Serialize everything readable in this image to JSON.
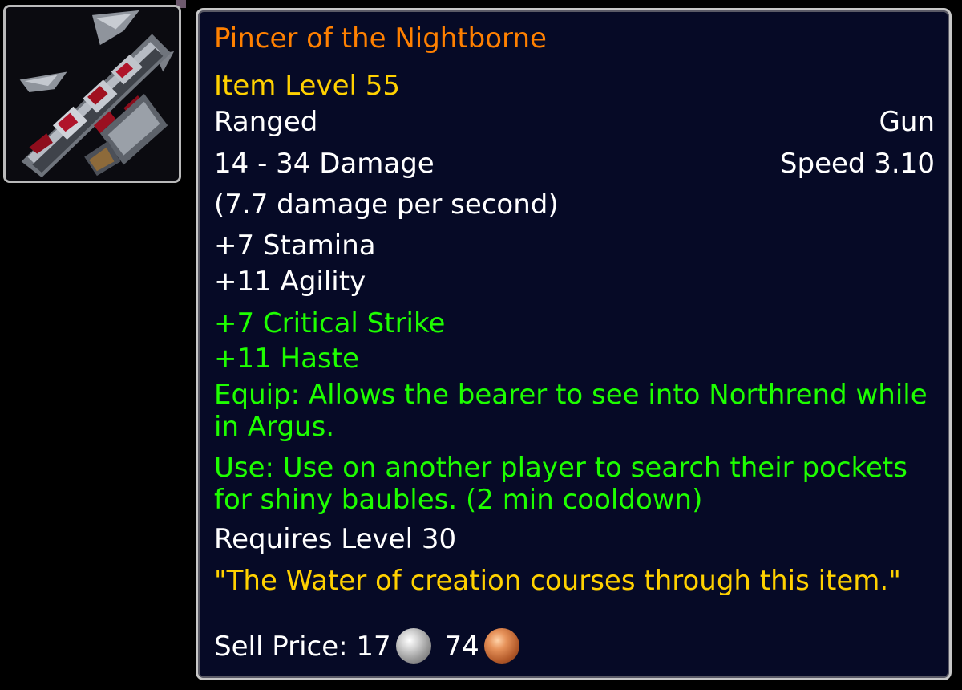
{
  "item": {
    "name": "Pincer of the Nightborne",
    "item_level": "Item Level 55",
    "slot": "Ranged",
    "type": "Gun",
    "damage": "14 - 34 Damage",
    "speed": "Speed 3.10",
    "dps": "(7.7 damage per second)",
    "stats": [
      "+7 Stamina",
      "+11 Agility"
    ],
    "secondary_stats": [
      "+7 Critical Strike",
      "+11 Haste"
    ],
    "equip_effect": "Equip: Allows the bearer to see into Northrend while in Argus.",
    "use_effect": "Use: Use on another player to search their pockets for shiny baubles. (2 min cooldown)",
    "requires": "Requires Level 30",
    "flavor": "\"The Water of creation courses through this item.\"",
    "sell_price": {
      "label": "Sell Price:",
      "silver": "17",
      "copper": "74"
    }
  },
  "icons": {
    "item_icon": "gun-icon",
    "silver_coin": "silver-coin-icon",
    "copper_coin": "copper-coin-icon"
  },
  "colors": {
    "legendary_name": "#ff8000",
    "item_level": "#ffd100",
    "normal_text": "#ffffff",
    "bonus_text": "#1eff00",
    "flavor_text": "#ffd100",
    "tooltip_bg": "#060a26",
    "border": "#c7c7c7"
  }
}
